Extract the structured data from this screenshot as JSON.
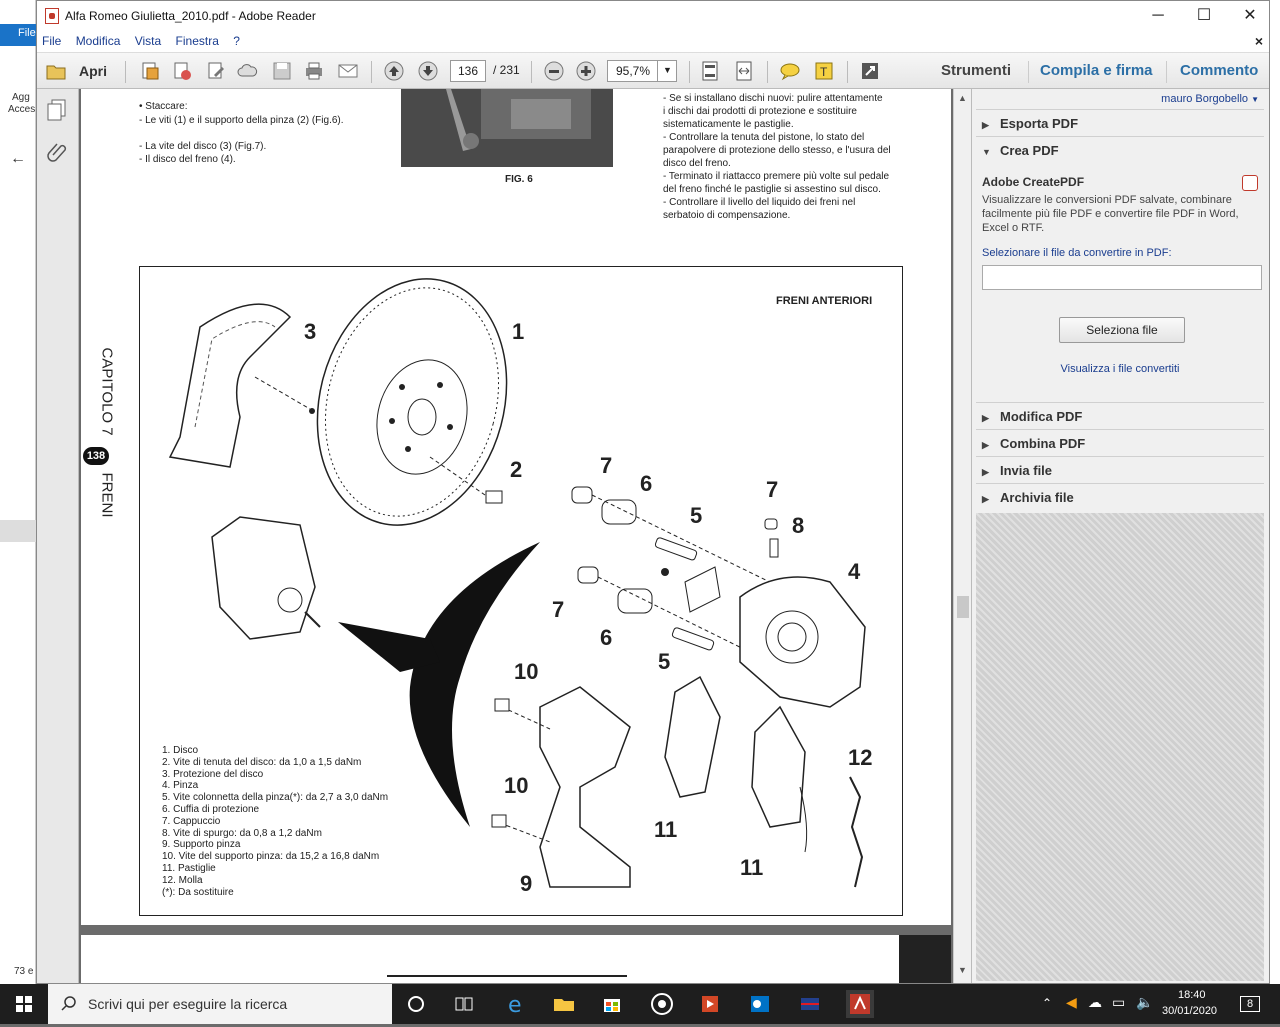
{
  "background_window": {
    "menu_label": "File",
    "text1": "Agg",
    "text2": "Acces",
    "status": "73 e"
  },
  "window": {
    "title": "Alfa Romeo Giulietta_2010.pdf - Adobe Reader",
    "minimize": "─",
    "maximize": "☐",
    "close": "✕"
  },
  "menubar": {
    "items": [
      "File",
      "Modifica",
      "Vista",
      "Finestra",
      "?"
    ],
    "close_doc": "×"
  },
  "toolbar": {
    "open_label": "Apri",
    "page_current": "136",
    "page_total": "/ 231",
    "zoom": "95,7%",
    "tabs": [
      "Strumenti",
      "Compila e firma",
      "Commento"
    ]
  },
  "document": {
    "left_col": [
      "• Staccare:",
      "- Le viti (1) e il supporto della pinza (2) (Fig.6).",
      "",
      "- La vite del disco (3) (Fig.7).",
      "- Il disco del freno (4)."
    ],
    "fig_caption": "FIG. 6",
    "right_col": [
      "- Se si installano dischi nuovi: pulire attentamente",
      "i dischi dai prodotti di protezione e sostituire",
      "sistematicamente le pastiglie.",
      "- Controllare la tenuta del pistone, lo stato del",
      "parapolvere di protezione dello stesso, e l'usura del",
      "disco del freno.",
      "- Terminato il riattacco premere più volte sul pedale",
      "del freno finché le pastiglie si assestino sul disco.",
      "- Controllare il livello del liquido dei freni nel",
      "serbatoio di compensazione."
    ],
    "side_chapter": "CAPITOLO 7",
    "side_page": "138",
    "side_section": "FRENI",
    "diagram_title": "FRENI ANTERIORI",
    "callouts": [
      "1",
      "2",
      "3",
      "4",
      "5",
      "5",
      "6",
      "6",
      "7",
      "7",
      "7",
      "8",
      "9",
      "10",
      "10",
      "11",
      "11",
      "12"
    ],
    "legend": [
      "1. Disco",
      "2. Vite di tenuta del disco: da 1,0 a 1,5 daNm",
      "3. Protezione del disco",
      "4. Pinza",
      "5. Vite colonnetta della pinza(*): da 2,7 a 3,0 daNm",
      "6. Cuffia di protezione",
      "7. Cappuccio",
      "8. Vite di spurgo: da 0,8 a 1,2 daNm",
      "9. Supporto pinza",
      "10. Vite del supporto pinza: da 15,2 a 16,8 daNm",
      "11. Pastiglie",
      "12. Molla",
      "(*): Da sostituire"
    ]
  },
  "right_pane": {
    "user": "mauro Borgobello",
    "sections_top": [
      {
        "label": "Esporta PDF",
        "arrow": "▶"
      },
      {
        "label": "Crea PDF",
        "arrow": "▼"
      }
    ],
    "create": {
      "heading": "Adobe CreatePDF",
      "description": "Visualizzare le conversioni PDF salvate, combinare facilmente più file PDF e convertire file PDF in Word, Excel o RTF.",
      "select_label": "Selezionare il file da convertire in PDF:",
      "button": "Seleziona file",
      "link": "Visualizza i file convertiti"
    },
    "sections_bottom": [
      {
        "label": "Modifica PDF",
        "arrow": "▶"
      },
      {
        "label": "Combina PDF",
        "arrow": "▶"
      },
      {
        "label": "Invia file",
        "arrow": "▶"
      },
      {
        "label": "Archivia file",
        "arrow": "▶"
      }
    ]
  },
  "taskbar": {
    "search_placeholder": "Scrivi qui per eseguire la ricerca",
    "time": "18:40",
    "date": "30/01/2020",
    "notifications": "8"
  }
}
